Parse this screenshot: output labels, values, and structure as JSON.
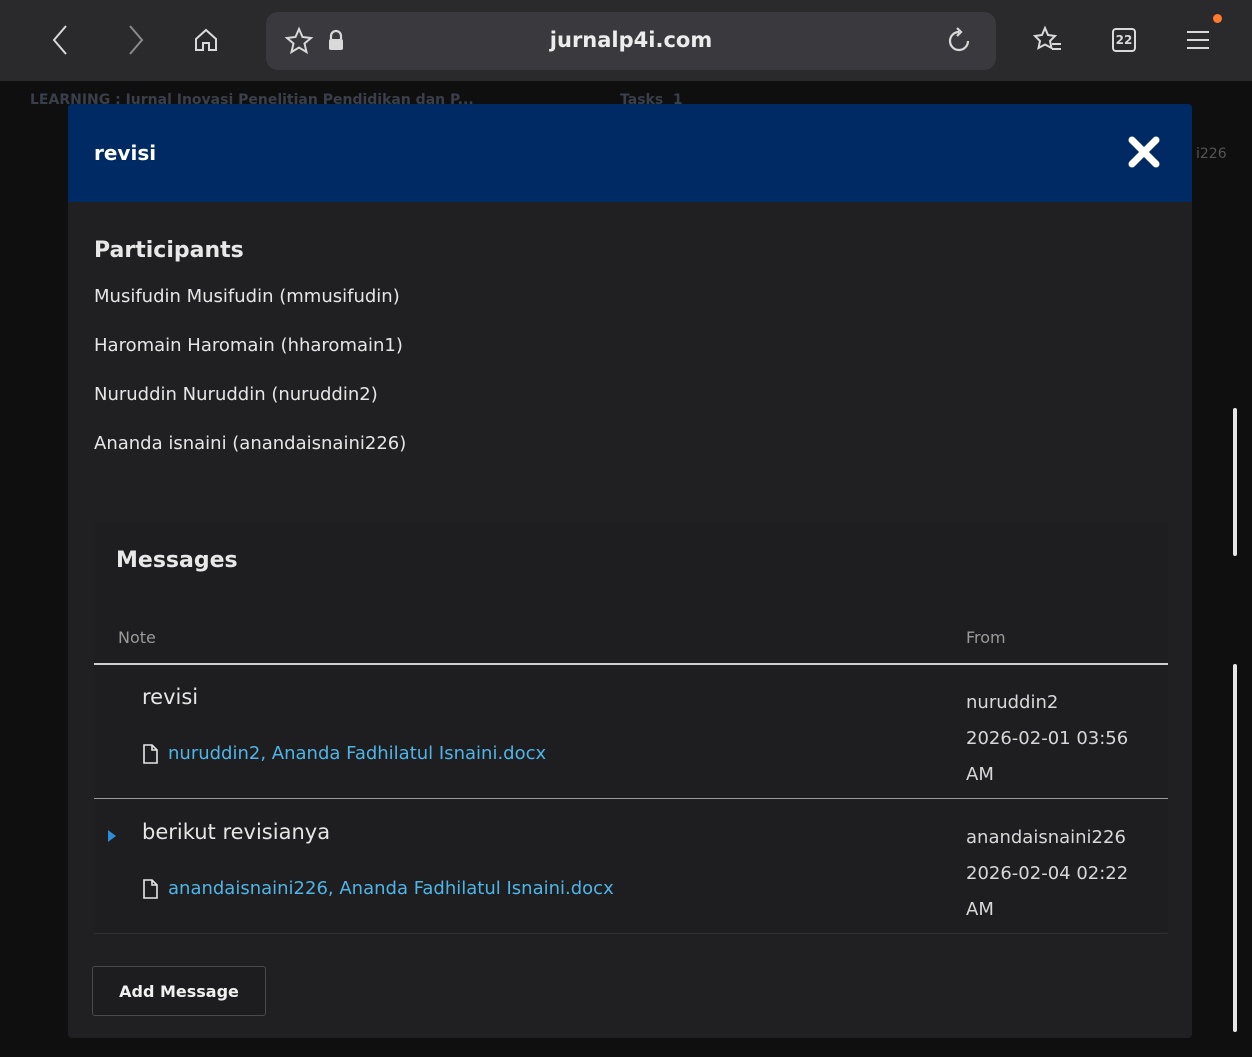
{
  "browser": {
    "url": "jurnalp4i.com",
    "tab_count": "22",
    "colors": {
      "toolbar": "#2a2a2d",
      "urlbar": "#3a3a3e",
      "notification_dot": "#ff7a2f"
    },
    "icons": [
      "back-icon",
      "forward-icon",
      "home-icon",
      "star-icon",
      "lock-icon",
      "reload-icon",
      "bookmarks-icon",
      "tabs-icon",
      "menu-icon"
    ]
  },
  "background_page": {
    "breadcrumb": "LEARNING : Jurnal Inovasi Penelitian Pendidikan dan P...",
    "tasks_label": "Tasks",
    "tasks_count": "1",
    "user_fragment": "i226"
  },
  "modal": {
    "title": "revisi",
    "header_color": "#002a64",
    "participants": {
      "heading": "Participants",
      "items": [
        "Musifudin Musifudin (mmusifudin)",
        "Haromain Haromain (hharomain1)",
        "Nuruddin Nuruddin (nuruddin2)",
        "Ananda isnaini (anandaisnaini226)"
      ]
    },
    "messages": {
      "heading": "Messages",
      "columns": {
        "note": "Note",
        "from": "From"
      },
      "rows": [
        {
          "note": "revisi",
          "file": "nuruddin2, Ananda Fadhilatul Isnaini.docx",
          "from_user": "nuruddin2",
          "date": "2026-02-01 03:56",
          "time_suffix": "AM"
        },
        {
          "note": "berikut revisianya",
          "file": "anandaisnaini226, Ananda Fadhilatul Isnaini.docx",
          "from_user": "anandaisnaini226",
          "date": "2026-02-04 02:22",
          "time_suffix": "AM"
        }
      ]
    },
    "add_message_label": "Add Message",
    "link_color": "#4fb5e6"
  }
}
